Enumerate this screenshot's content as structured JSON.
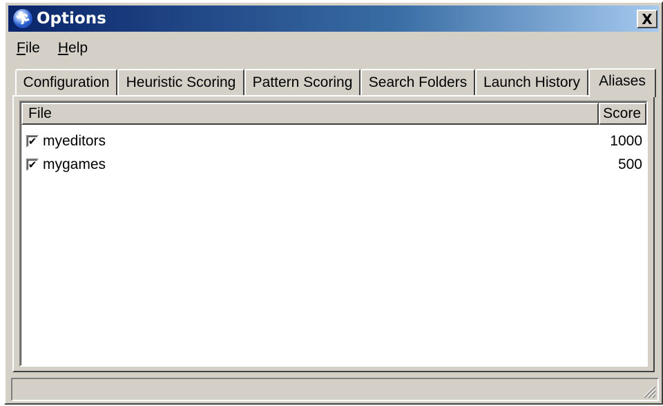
{
  "window": {
    "title": "Options",
    "close_label": "X"
  },
  "menu": {
    "file_label": "File",
    "file_mnemonic": "F",
    "file_rest": "ile",
    "help_label": "Help",
    "help_mnemonic": "H",
    "help_rest": "elp"
  },
  "tabs": [
    {
      "label": "Configuration",
      "active": false
    },
    {
      "label": "Heuristic Scoring",
      "active": false
    },
    {
      "label": "Pattern Scoring",
      "active": false
    },
    {
      "label": "Search Folders",
      "active": false
    },
    {
      "label": "Launch History",
      "active": false
    },
    {
      "label": "Aliases",
      "active": true
    }
  ],
  "list": {
    "columns": {
      "file": "File",
      "score": "Score"
    },
    "rows": [
      {
        "checked": true,
        "name": "myeditors",
        "score": "1000"
      },
      {
        "checked": true,
        "name": "mygames",
        "score": "500"
      }
    ]
  },
  "statusbar": {
    "text": ""
  },
  "icons": {
    "app": "running-man-icon",
    "checkmark": "✔"
  },
  "colors": {
    "titlebar_start": "#0a246a",
    "titlebar_end": "#a6caf0",
    "face": "#d4d0c8"
  }
}
